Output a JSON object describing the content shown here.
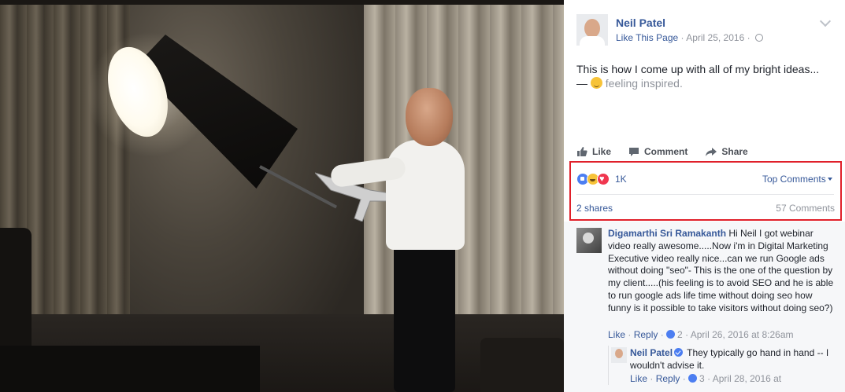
{
  "post": {
    "author": "Neil Patel",
    "like_page": "Like This Page",
    "date_sep": " · ",
    "date": "April 25, 2016",
    "date_after": " · ",
    "text": "This is how I come up with all of my bright ideas...",
    "feeling_prefix": "— ",
    "feeling": "feeling inspired."
  },
  "actions": {
    "like": "Like",
    "comment": "Comment",
    "share": "Share"
  },
  "reactions": {
    "count": "1K",
    "top_comments": "Top Comments",
    "shares": "2 shares",
    "comments_count": "57 Comments"
  },
  "comments": [
    {
      "name": "Digamarthi Sri Ramakanth",
      "text": " Hi Neil I got webinar video really awesome.....Now i'm in Digital Marketing Executive video really nice...can we run Google ads without doing \"seo\"- This is the one of the question by my client.....(his feeling is to avoid SEO and he is able to run google ads life time without doing seo how funny is it possible to take visitors without doing seo?)",
      "like": "Like",
      "dot1": " · ",
      "reply": "Reply",
      "dot2": " · ",
      "likes": "2",
      "dot3": " · ",
      "date": "April 26, 2016 at 8:26am"
    },
    {
      "name": "Neil Patel",
      "text": " They typically go hand in hand -- I wouldn't advise it.",
      "like": "Like",
      "dot1": " · ",
      "reply": "Reply",
      "dot2": " · ",
      "likes": "3",
      "dot3": " · ",
      "date": "April 28, 2016 at"
    }
  ],
  "icons": {
    "privacy": "globe-icon",
    "menu": "chevron-down-icon",
    "feeling": "smiley-icon",
    "verified": "verified-badge-icon"
  },
  "colors": {
    "link": "#365899",
    "highlight": "#e0202a",
    "muted": "#90949c"
  }
}
